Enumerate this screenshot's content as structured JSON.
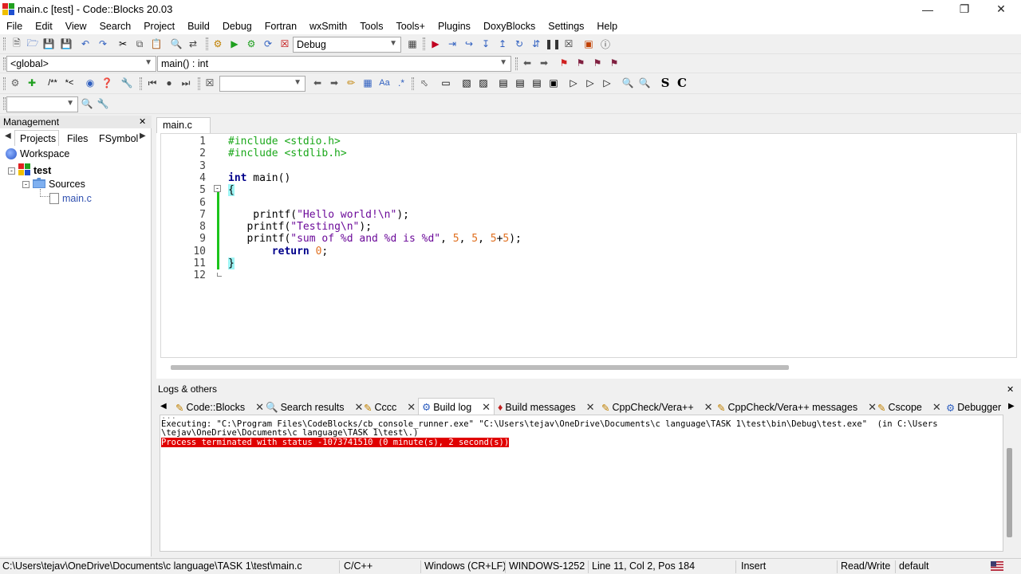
{
  "window": {
    "title": "main.c [test] - Code::Blocks 20.03",
    "controls": [
      "minimize-icon",
      "maximize-icon",
      "close-icon"
    ]
  },
  "menu": [
    "File",
    "Edit",
    "View",
    "Search",
    "Project",
    "Build",
    "Debug",
    "Fortran",
    "wxSmith",
    "Tools",
    "Tools+",
    "Plugins",
    "DoxyBlocks",
    "Settings",
    "Help"
  ],
  "toolbar": {
    "build_target": "Debug",
    "scope": "<global>",
    "function": "main() : int",
    "search_value": "",
    "find_value": ""
  },
  "management": {
    "title": "Management",
    "tabs": [
      "Projects",
      "Files",
      "FSymbol"
    ],
    "tree": {
      "workspace": "Workspace",
      "project": "test",
      "folder": "Sources",
      "file": "main.c"
    }
  },
  "editor": {
    "tab": "main.c",
    "line_numbers": [
      "1",
      "2",
      "3",
      "4",
      "5",
      "6",
      "7",
      "8",
      "9",
      "10",
      "11",
      "12"
    ],
    "code": [
      "#include <stdio.h>",
      "#include <stdlib.h>",
      "",
      "int main()",
      "{",
      "",
      "    printf(\"Hello world!\\n\");",
      "   printf(\"Testing\\n\");",
      "   printf(\"sum of %d and %d is %d\", 5, 5, 5+5);",
      "       return 0;",
      "}",
      ""
    ]
  },
  "logs": {
    "title": "Logs & others",
    "tabs": [
      "Code::Blocks",
      "Search results",
      "Cccc",
      "Build log",
      "Build messages",
      "CppCheck/Vera++",
      "CppCheck/Vera++ messages",
      "Cscope",
      "Debugger"
    ],
    "active_tab": "Build log",
    "lines": [
      "Executing: \"C:\\Program Files\\CodeBlocks/cb_console_runner.exe\" \"C:\\Users\\tejav\\OneDrive\\Documents\\c language\\TASK 1\\test\\bin\\Debug\\test.exe\"  (in C:\\Users",
      "\\tejav\\OneDrive\\Documents\\c language\\TASK 1\\test\\.)",
      "Process terminated with status -1073741510 (0 minute(s), 2 second(s))"
    ],
    "error_color": "#e00000"
  },
  "status": {
    "path": "C:\\Users\\tejav\\OneDrive\\Documents\\c language\\TASK 1\\test\\main.c",
    "lang": "C/C++",
    "eol": "Windows (CR+LF)",
    "encoding": "WINDOWS-1252",
    "position": "Line 11, Col 2, Pos 184",
    "mode": "Insert",
    "access": "Read/Write",
    "profile": "default"
  }
}
